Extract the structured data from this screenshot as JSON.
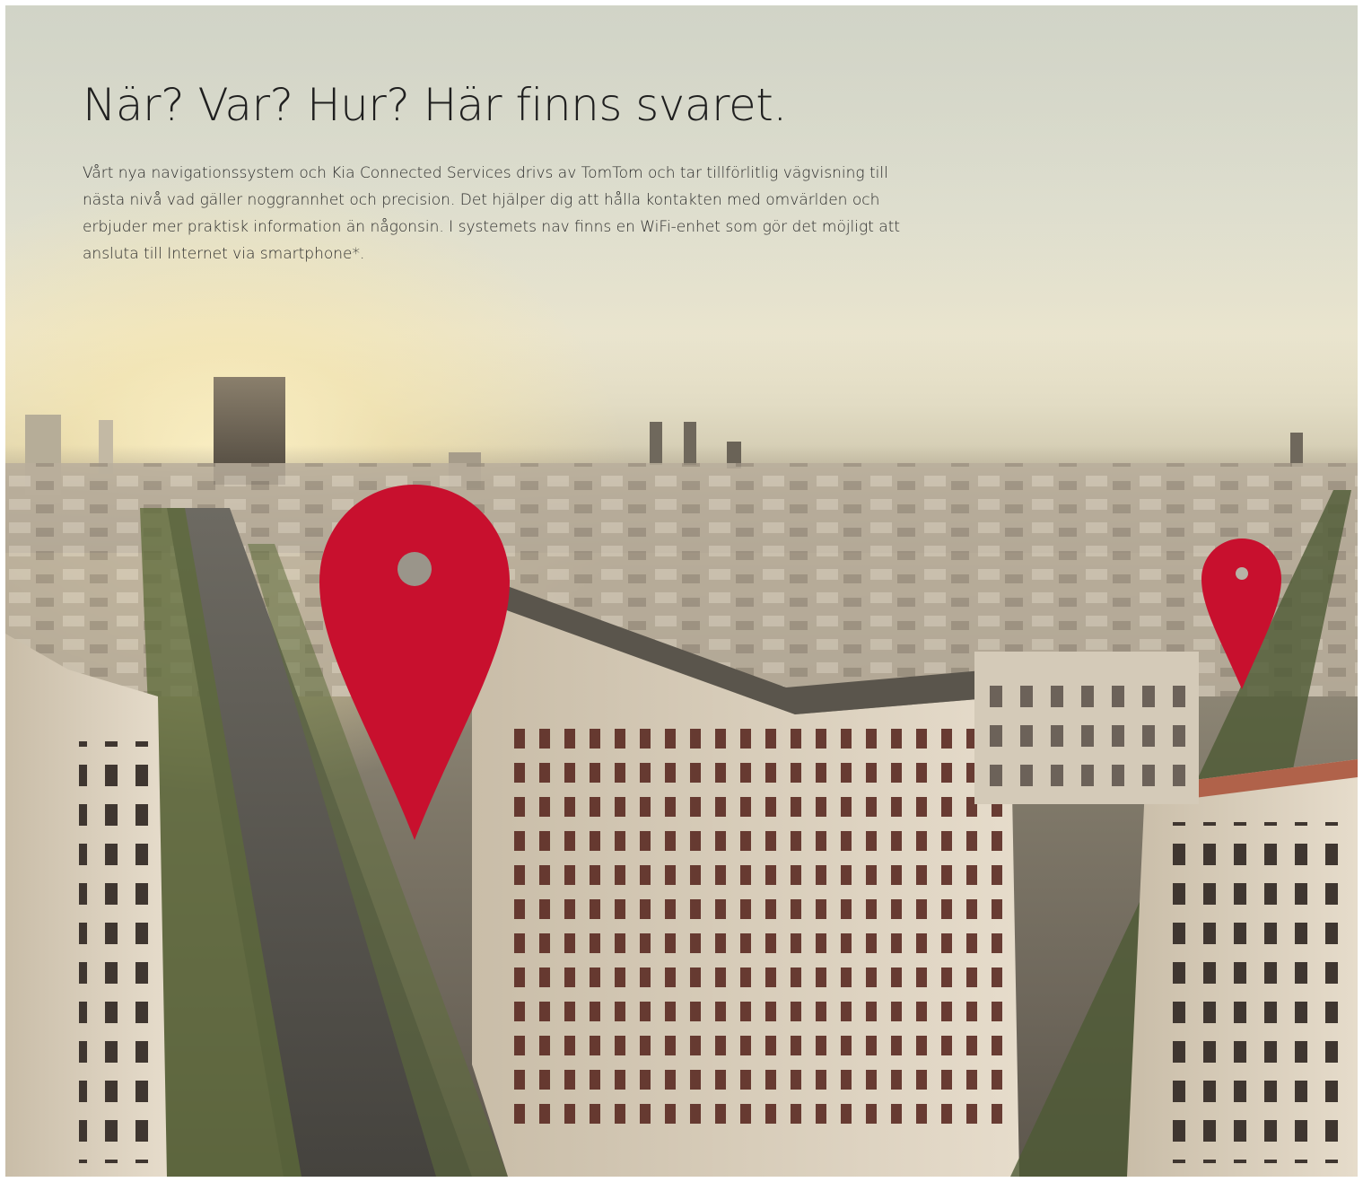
{
  "hero": {
    "title": "När? Var? Hur? Här finns svaret.",
    "body": "Vårt nya navigationssystem och Kia Connected Services drivs av TomTom och tar tillförlitlig vägvisning till nästa nivå vad gäller noggrannhet och precision. Det hjälper dig att hålla kontakten med omvärlden och erbjuder mer praktisk information än någonsin. I systemets nav finns en WiFi-enhet som gör det möjligt att ansluta till Internet via smartphone*."
  },
  "colors": {
    "pin": "#c8102e",
    "pin_hole": "#9a958a",
    "text": "#2a2a2a"
  },
  "icons": {
    "large_pin": "map-pin-icon",
    "small_pin": "map-pin-icon"
  }
}
